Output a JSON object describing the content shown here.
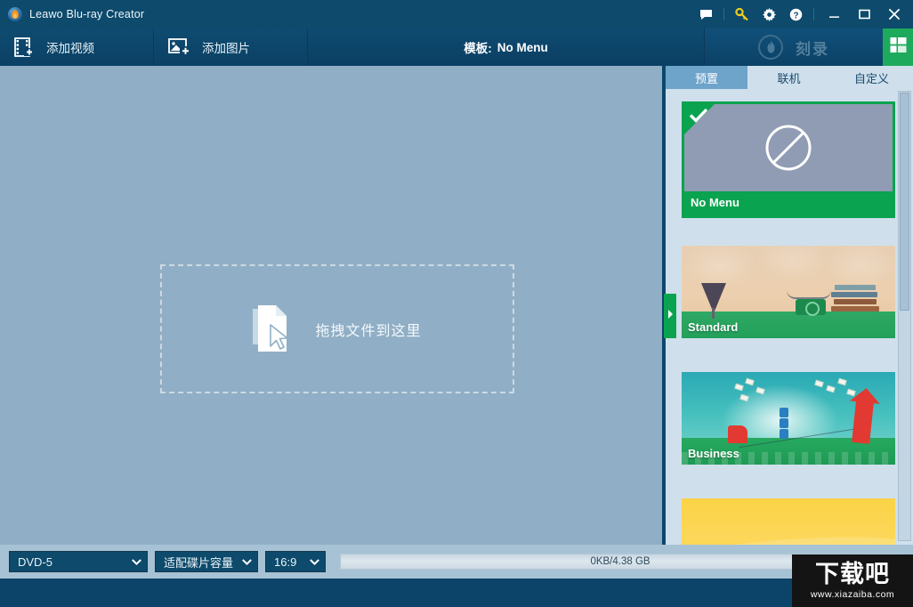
{
  "window": {
    "title": "Leawo Blu-ray Creator",
    "app_icon": "disc-flame-icon",
    "titlebar_icons": [
      {
        "name": "feedback-icon",
        "label": "Feedback"
      },
      {
        "name": "key-icon",
        "label": "Register"
      },
      {
        "name": "gear-icon",
        "label": "Settings"
      },
      {
        "name": "help-icon",
        "label": "Help"
      }
    ],
    "controls": {
      "minimize": "Minimize",
      "maximize": "Maximize",
      "close": "Close"
    }
  },
  "toolbar": {
    "add_video": "添加视频",
    "add_photo": "添加图片",
    "template_prefix": "模板:",
    "template_value": "No Menu",
    "burn_label": "刻录",
    "burn_icon": "flame-circle-icon",
    "layout_button_icon": "panel-layout-icon"
  },
  "main": {
    "dropzone_text": "拖拽文件到这里",
    "dropzone_icon": "file-cursor-icon",
    "collapse_handle_icon": "chevron-right-icon"
  },
  "panel": {
    "tabs": [
      {
        "label": "预置",
        "active": true
      },
      {
        "label": "联机",
        "active": false
      },
      {
        "label": "自定义",
        "active": false
      }
    ],
    "templates": [
      {
        "name": "No Menu",
        "selected": true,
        "art": "no-menu"
      },
      {
        "name": "Standard",
        "selected": false,
        "art": "standard"
      },
      {
        "name": "Business",
        "selected": false,
        "art": "business"
      },
      {
        "name": "",
        "selected": false,
        "art": "yellow"
      }
    ]
  },
  "bottom": {
    "disc_type": "DVD-5",
    "fit_mode": "适配碟片容量",
    "aspect_ratio": "16:9",
    "capacity_text": "0KB/4.38 GB"
  },
  "watermark": {
    "cn": "下载吧",
    "url": "www.xiazaiba.com"
  },
  "colors": {
    "titlebar": "#0d4a6b",
    "toolbar": "#0c4469",
    "main_canvas": "#90afc6",
    "panel_bg": "#cfe0ec",
    "accent_green": "#0aa34f",
    "tab_active": "#6ea3ca",
    "bottom_bar": "#a7c2d5"
  }
}
